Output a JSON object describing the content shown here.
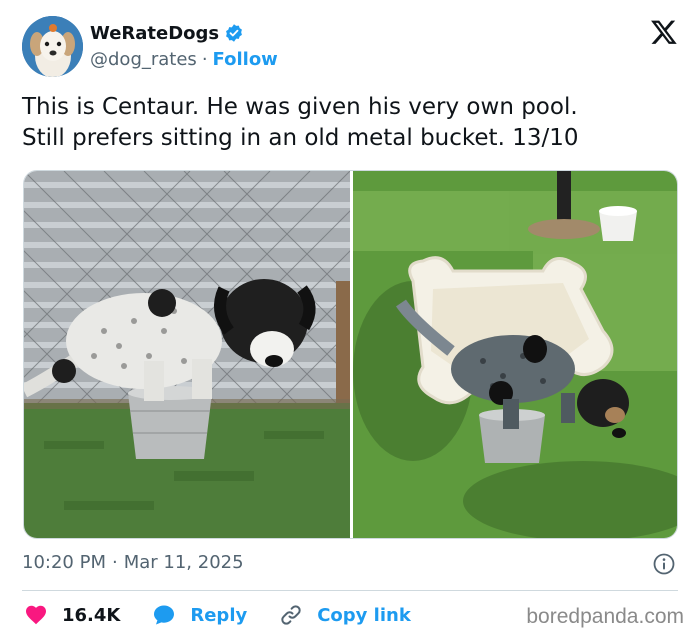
{
  "author": {
    "display_name": "WeRateDogs",
    "handle": "@dog_rates",
    "separator": "·",
    "follow_label": "Follow",
    "verified": true
  },
  "tweet": {
    "text": "This is Centaur. He was given his very own pool.\nStill prefers sitting in an old metal bucket. 13/10"
  },
  "media": {
    "left_photo": "dog-in-bucket-fence",
    "right_photo": "dog-in-bucket-pool"
  },
  "meta": {
    "time": "10:20 PM",
    "separator": "·",
    "date": "Mar 11, 2025"
  },
  "actions": {
    "likes": "16.4K",
    "reply_label": "Reply",
    "copy_label": "Copy link"
  },
  "watermark": "boredpanda.com",
  "colors": {
    "accent": "#1d9bf0",
    "like": "#f91880",
    "text": "#0f1419",
    "muted": "#536471"
  },
  "icons": {
    "verified": "verified-badge-icon",
    "logo": "x-logo-icon",
    "info": "info-icon",
    "like": "heart-icon",
    "reply": "speech-bubble-icon",
    "copy": "link-icon"
  }
}
